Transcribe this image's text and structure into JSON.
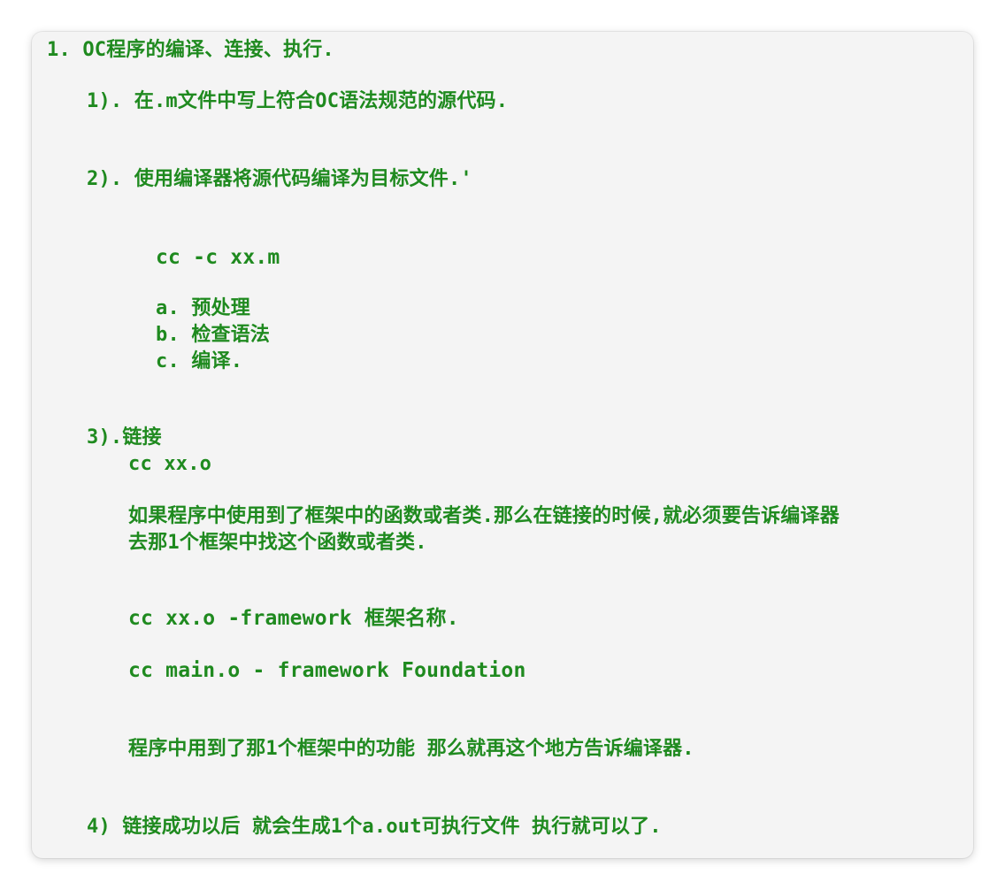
{
  "notes": {
    "heading": "1. OC程序的编译、连接、执行.",
    "step1": "1). 在.m文件中写上符合OC语法规范的源代码.",
    "step2": "2). 使用编译器将源代码编译为目标文件.'",
    "compile_cmd": "cc -c xx.m",
    "sub_a": "a. 预处理",
    "sub_b": "b. 检查语法",
    "sub_c": "c. 编译.",
    "step3": "3).链接",
    "link_cmd": "cc xx.o",
    "explain_line1": "如果程序中使用到了框架中的函数或者类.那么在链接的时候,就必须要告诉编译器",
    "explain_line2": "去那1个框架中找这个函数或者类.",
    "framework_cmd": "cc xx.o -framework 框架名称.",
    "foundation_cmd": "cc main.o - framework Foundation",
    "framework_note": "程序中用到了那1个框架中的功能 那么就再这个地方告诉编译器.",
    "step4": "4) 链接成功以后 就会生成1个a.out可执行文件 执行就可以了."
  },
  "colors": {
    "text": "#1f8a1f",
    "background": "#f4f4f4"
  }
}
